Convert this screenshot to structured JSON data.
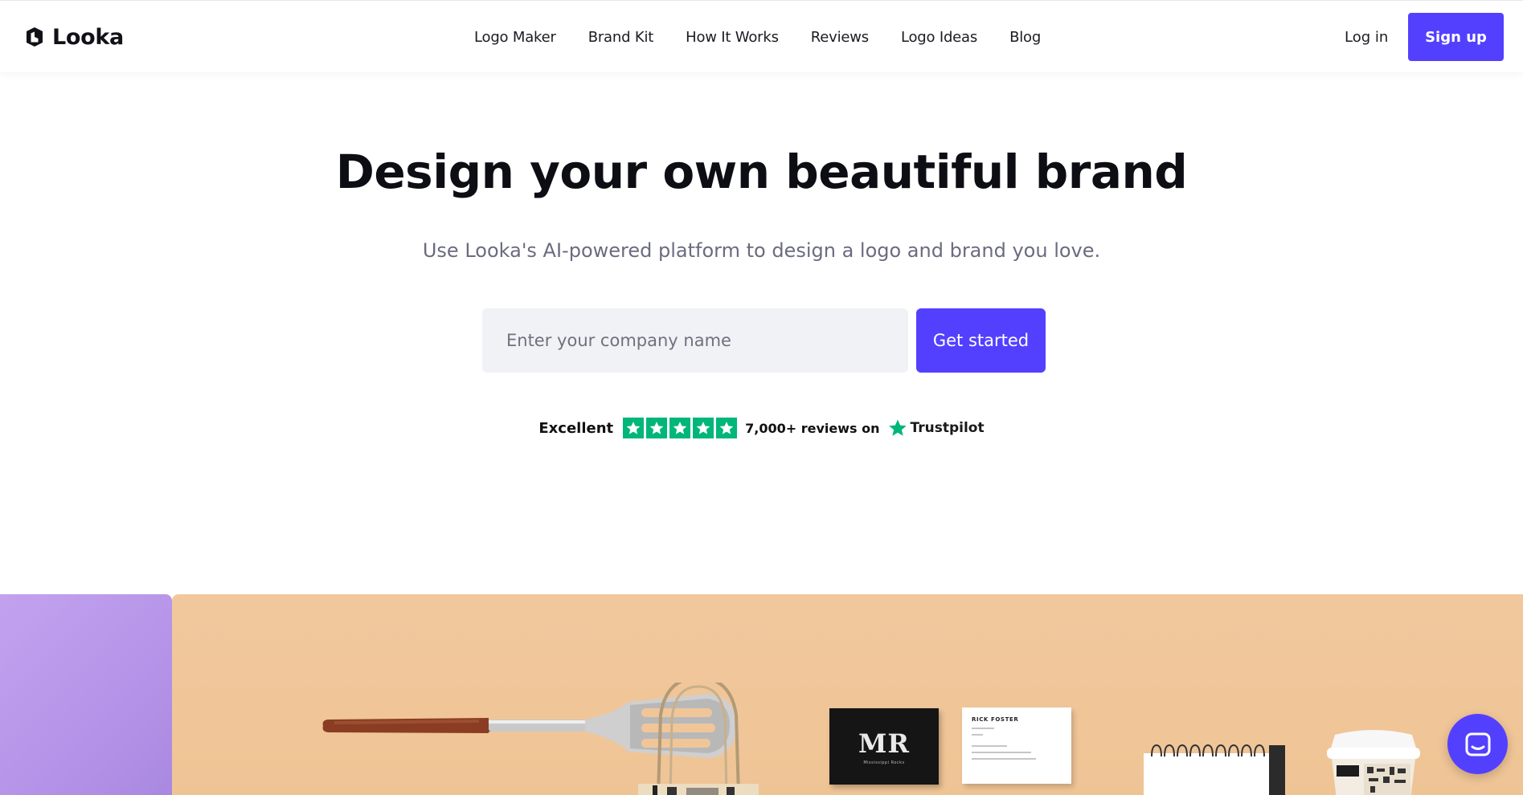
{
  "nav": {
    "brand": "Looka",
    "links": [
      "Logo Maker",
      "Brand Kit",
      "How It Works",
      "Reviews",
      "Logo Ideas",
      "Blog"
    ],
    "login": "Log in",
    "signup": "Sign up"
  },
  "hero": {
    "title": "Design your own beautiful brand",
    "subtitle": "Use Looka's AI-powered platform to design a logo and brand you love.",
    "input_placeholder": "Enter your company name",
    "cta": "Get started"
  },
  "trust": {
    "rating_word": "Excellent",
    "stars": 5,
    "reviews": "7,000+ reviews on",
    "platform": "Trustpilot"
  },
  "showcase": {
    "card_monogram": "MR",
    "card_subline": "Mississippi Rocks",
    "card_name": "RICK FOSTER"
  },
  "colors": {
    "accent": "#5340ff",
    "trustpilot_green": "#00b67a",
    "showcase_bg": "#f0c699",
    "showcase_side": "#b898ea"
  },
  "icons": {
    "brand": "looka-logo-icon",
    "star": "star-icon",
    "chat": "chat-icon"
  }
}
